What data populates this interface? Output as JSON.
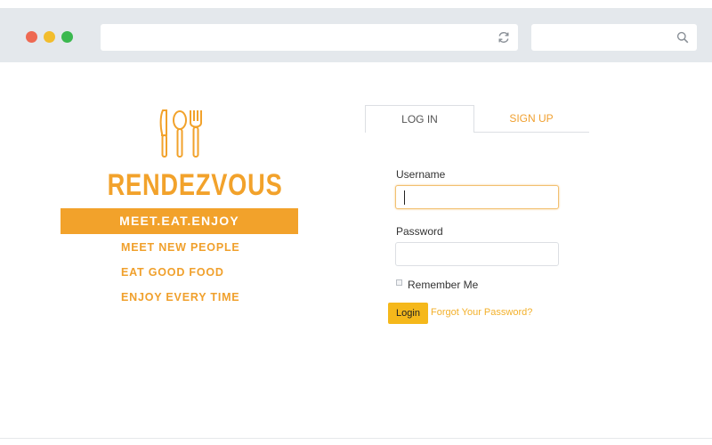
{
  "window": {
    "url_value": "",
    "search_value": "",
    "icons": {
      "reload": "reload-icon",
      "search": "search-icon"
    }
  },
  "brand": {
    "logo_icon": "utensils-icon",
    "name": "RENDEZVOUS",
    "tagline": "MEET.EAT.ENJOY",
    "mottos": [
      "MEET NEW PEOPLE",
      "EAT GOOD FOOD",
      "ENJOY EVERY TIME"
    ]
  },
  "tabs": {
    "login": "LOG IN",
    "signup": "SIGN UP",
    "active": "login"
  },
  "form": {
    "username_label": "Username",
    "username_value": "",
    "password_label": "Password",
    "password_value": "",
    "remember_label": "Remember Me",
    "remember_checked": false,
    "login_button": "Login",
    "forgot_link": "Forgot Your Password?"
  },
  "colors": {
    "brand_orange": "#f2a22b",
    "button_yellow": "#f5b81b",
    "chrome_gray": "#e4e8ec"
  }
}
